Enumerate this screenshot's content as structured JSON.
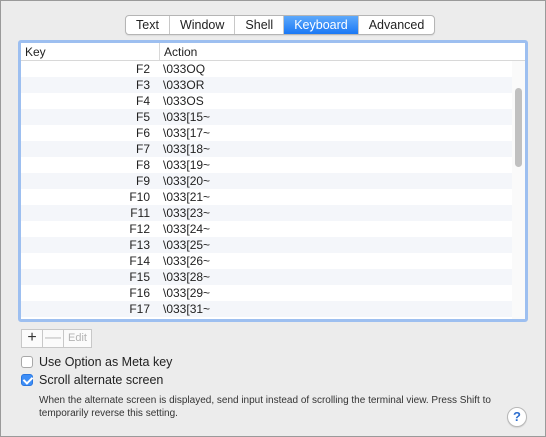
{
  "tabs": [
    {
      "label": "Text"
    },
    {
      "label": "Window"
    },
    {
      "label": "Shell"
    },
    {
      "label": "Keyboard",
      "active": true
    },
    {
      "label": "Advanced"
    }
  ],
  "table": {
    "headers": {
      "key": "Key",
      "action": "Action"
    },
    "rows": [
      {
        "key": "F2",
        "action": "\\033OQ"
      },
      {
        "key": "F3",
        "action": "\\033OR"
      },
      {
        "key": "F4",
        "action": "\\033OS"
      },
      {
        "key": "F5",
        "action": "\\033[15~"
      },
      {
        "key": "F6",
        "action": "\\033[17~"
      },
      {
        "key": "F7",
        "action": "\\033[18~"
      },
      {
        "key": "F8",
        "action": "\\033[19~"
      },
      {
        "key": "F9",
        "action": "\\033[20~"
      },
      {
        "key": "F10",
        "action": "\\033[21~"
      },
      {
        "key": "F11",
        "action": "\\033[23~"
      },
      {
        "key": "F12",
        "action": "\\033[24~"
      },
      {
        "key": "F13",
        "action": "\\033[25~"
      },
      {
        "key": "F14",
        "action": "\\033[26~"
      },
      {
        "key": "F15",
        "action": "\\033[28~"
      },
      {
        "key": "F16",
        "action": "\\033[29~"
      },
      {
        "key": "F17",
        "action": "\\033[31~"
      }
    ]
  },
  "buttons": {
    "add": "+",
    "remove": "—",
    "edit": "Edit"
  },
  "options": {
    "meta_key": {
      "label": "Use Option as Meta key",
      "checked": false
    },
    "scroll_alt": {
      "label": "Scroll alternate screen",
      "checked": true
    }
  },
  "note": "When the alternate screen is displayed, send input instead of scrolling the terminal view. Press Shift to temporarily reverse this setting.",
  "help": "?",
  "colors": {
    "accent": "#1a78f5",
    "focus_ring": "#9dbff0"
  }
}
